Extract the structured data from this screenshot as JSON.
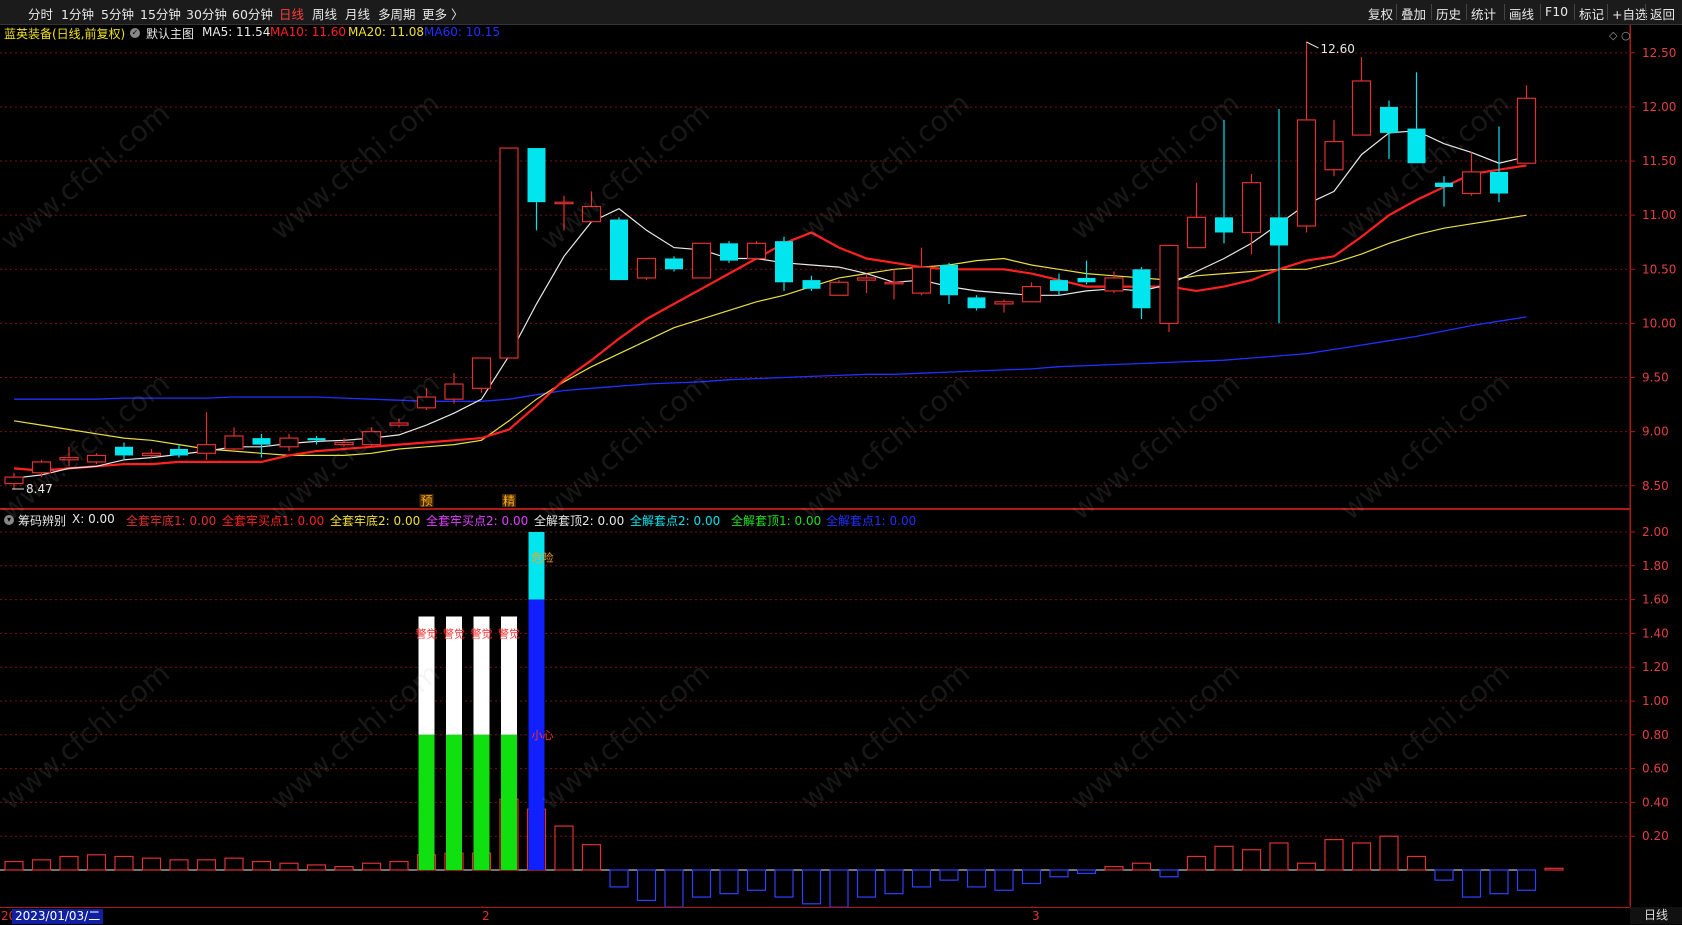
{
  "toolbar": {
    "periods": [
      "分时",
      "1分钟",
      "5分钟",
      "15分钟",
      "30分钟",
      "60分钟",
      "日线",
      "周线",
      "月线",
      "多周期",
      "更多 〉"
    ],
    "active_period": "日线",
    "tools": [
      "复权",
      "叠加",
      "历史",
      "统计",
      "画线",
      "F10",
      "标记",
      "+自选",
      "返回"
    ]
  },
  "main_title": {
    "stock": "蓝英装备(日线,前复权)",
    "chart_name": "默认主图",
    "ma5": "MA5: 11.54",
    "ma10": "MA10: 11.60",
    "ma20": "MA20: 11.08",
    "ma60": "MA60: 10.15"
  },
  "indicator_title": {
    "name": "筹码辨别",
    "x": "X: 0.00",
    "v1": "全套牢底1: 0.00",
    "v2": "全套牢买点1: 0.00",
    "v3": "全套牢底2: 0.00",
    "v4": "全套牢买点2: 0.00",
    "v5": "全解套顶2: 0.00",
    "v6": "全解套点2: 0.00",
    "v7": "全解套顶1: 0.00",
    "v8": "全解套点1: 0.00"
  },
  "price_axis": [
    "12.50",
    "12.00",
    "11.50",
    "11.00",
    "10.50",
    "10.00",
    "9.50",
    "9.00",
    "8.50"
  ],
  "ind_axis": [
    "2.00",
    "1.80",
    "1.60",
    "1.40",
    "1.20",
    "1.00",
    "0.80",
    "0.60",
    "0.40",
    "0.20"
  ],
  "annotations": {
    "high": "12.60",
    "low": "8.47",
    "mark1": "预",
    "mark2": "精",
    "warn": "警觉",
    "danger": "危险",
    "careful": "小心"
  },
  "bottom": {
    "date": "2023/01/03/二",
    "year_prefix": "20",
    "month2": "2",
    "month3": "3",
    "period_label": "日线"
  },
  "watermark": "www.cfchi.com",
  "colors": {
    "up": "#e03030",
    "down": "#00e5ee",
    "ma5": "#e8e8e8",
    "ma10": "#ff2020",
    "ma20": "#e8e040",
    "ma60": "#2030ff",
    "grid": "#7a1010"
  },
  "chart_data": {
    "type": "candlestick",
    "candles": [
      {
        "o": 8.52,
        "c": 8.58,
        "h": 8.62,
        "l": 8.47
      },
      {
        "o": 8.62,
        "c": 8.72,
        "h": 8.74,
        "l": 8.58
      },
      {
        "o": 8.74,
        "c": 8.76,
        "h": 8.86,
        "l": 8.68
      },
      {
        "o": 8.72,
        "c": 8.78,
        "h": 8.8,
        "l": 8.7
      },
      {
        "o": 8.86,
        "c": 8.78,
        "h": 8.9,
        "l": 8.74
      },
      {
        "o": 8.78,
        "c": 8.8,
        "h": 8.84,
        "l": 8.76
      },
      {
        "o": 8.84,
        "c": 8.78,
        "h": 8.88,
        "l": 8.76
      },
      {
        "o": 8.8,
        "c": 8.88,
        "h": 9.18,
        "l": 8.74
      },
      {
        "o": 8.84,
        "c": 8.96,
        "h": 9.04,
        "l": 8.82
      },
      {
        "o": 8.94,
        "c": 8.88,
        "h": 8.98,
        "l": 8.76
      },
      {
        "o": 8.86,
        "c": 8.94,
        "h": 8.98,
        "l": 8.82
      },
      {
        "o": 8.94,
        "c": 8.92,
        "h": 8.96,
        "l": 8.88
      },
      {
        "o": 8.88,
        "c": 8.9,
        "h": 8.94,
        "l": 8.86
      },
      {
        "o": 8.88,
        "c": 9.0,
        "h": 9.04,
        "l": 8.86
      },
      {
        "o": 9.06,
        "c": 9.08,
        "h": 9.12,
        "l": 9.04
      },
      {
        "o": 9.22,
        "c": 9.32,
        "h": 9.4,
        "l": 9.2
      },
      {
        "o": 9.3,
        "c": 9.44,
        "h": 9.54,
        "l": 9.26
      },
      {
        "o": 9.4,
        "c": 9.68,
        "h": 9.68,
        "l": 9.36
      },
      {
        "o": 9.68,
        "c": 11.62,
        "h": 11.62,
        "l": 9.68
      },
      {
        "o": 11.62,
        "c": 11.12,
        "h": 11.62,
        "l": 10.86
      },
      {
        "o": 11.12,
        "c": 11.12,
        "h": 11.18,
        "l": 10.86
      },
      {
        "o": 10.94,
        "c": 11.08,
        "h": 11.22,
        "l": 10.94
      },
      {
        "o": 10.96,
        "c": 10.4,
        "h": 10.98,
        "l": 10.4
      },
      {
        "o": 10.42,
        "c": 10.6,
        "h": 10.6,
        "l": 10.4
      },
      {
        "o": 10.6,
        "c": 10.5,
        "h": 10.62,
        "l": 10.48
      },
      {
        "o": 10.42,
        "c": 10.74,
        "h": 10.74,
        "l": 10.42
      },
      {
        "o": 10.74,
        "c": 10.58,
        "h": 10.76,
        "l": 10.56
      },
      {
        "o": 10.6,
        "c": 10.74,
        "h": 10.76,
        "l": 10.6
      },
      {
        "o": 10.76,
        "c": 10.38,
        "h": 10.8,
        "l": 10.3
      },
      {
        "o": 10.4,
        "c": 10.32,
        "h": 10.44,
        "l": 10.3
      },
      {
        "o": 10.26,
        "c": 10.38,
        "h": 10.4,
        "l": 10.26
      },
      {
        "o": 10.4,
        "c": 10.42,
        "h": 10.46,
        "l": 10.28
      },
      {
        "o": 10.38,
        "c": 10.38,
        "h": 10.5,
        "l": 10.22
      },
      {
        "o": 10.28,
        "c": 10.52,
        "h": 10.7,
        "l": 10.26
      },
      {
        "o": 10.54,
        "c": 10.26,
        "h": 10.56,
        "l": 10.18
      },
      {
        "o": 10.24,
        "c": 10.14,
        "h": 10.26,
        "l": 10.12
      },
      {
        "o": 10.18,
        "c": 10.2,
        "h": 10.22,
        "l": 10.1
      },
      {
        "o": 10.2,
        "c": 10.34,
        "h": 10.38,
        "l": 10.2
      },
      {
        "o": 10.4,
        "c": 10.3,
        "h": 10.46,
        "l": 10.26
      },
      {
        "o": 10.42,
        "c": 10.38,
        "h": 10.58,
        "l": 10.36
      },
      {
        "o": 10.3,
        "c": 10.42,
        "h": 10.48,
        "l": 10.28
      },
      {
        "o": 10.5,
        "c": 10.14,
        "h": 10.52,
        "l": 10.04
      },
      {
        "o": 10.0,
        "c": 10.72,
        "h": 10.72,
        "l": 9.92
      },
      {
        "o": 10.7,
        "c": 10.98,
        "h": 11.3,
        "l": 10.7
      },
      {
        "o": 10.98,
        "c": 10.84,
        "h": 11.88,
        "l": 10.74
      },
      {
        "o": 10.84,
        "c": 11.3,
        "h": 11.38,
        "l": 10.64
      },
      {
        "o": 10.98,
        "c": 10.72,
        "h": 11.98,
        "l": 10.0
      },
      {
        "o": 10.9,
        "c": 11.88,
        "h": 12.6,
        "l": 10.84
      },
      {
        "o": 11.42,
        "c": 11.68,
        "h": 11.88,
        "l": 11.36
      },
      {
        "o": 11.74,
        "c": 12.24,
        "h": 12.46,
        "l": 11.74
      },
      {
        "o": 12.0,
        "c": 11.76,
        "h": 12.06,
        "l": 11.52
      },
      {
        "o": 11.8,
        "c": 11.48,
        "h": 12.32,
        "l": 11.48
      },
      {
        "o": 11.3,
        "c": 11.26,
        "h": 11.36,
        "l": 11.08
      },
      {
        "o": 11.2,
        "c": 11.4,
        "h": 11.58,
        "l": 11.18
      },
      {
        "o": 11.4,
        "c": 11.2,
        "h": 11.82,
        "l": 11.12
      },
      {
        "o": 11.48,
        "c": 12.08,
        "h": 12.2,
        "l": 11.48
      }
    ],
    "ma5": [
      8.57,
      8.6,
      8.66,
      8.68,
      8.74,
      8.76,
      8.79,
      8.82,
      8.86,
      8.86,
      8.89,
      8.91,
      8.92,
      8.94,
      8.97,
      9.06,
      9.17,
      9.3,
      9.7,
      10.18,
      10.62,
      10.94,
      11.06,
      10.86,
      10.7,
      10.68,
      10.6,
      10.6,
      10.56,
      10.54,
      10.52,
      10.46,
      10.38,
      10.4,
      10.34,
      10.3,
      10.28,
      10.26,
      10.26,
      10.3,
      10.32,
      10.3,
      10.36,
      10.48,
      10.6,
      10.74,
      10.92,
      11.1,
      11.22,
      11.56,
      11.76,
      11.78,
      11.66,
      11.58,
      11.48,
      11.54
    ],
    "ma10": [
      8.66,
      8.64,
      8.66,
      8.68,
      8.7,
      8.7,
      8.72,
      8.72,
      8.72,
      8.72,
      8.78,
      8.82,
      8.84,
      8.86,
      8.88,
      8.9,
      8.92,
      8.94,
      9.02,
      9.24,
      9.48,
      9.66,
      9.86,
      10.04,
      10.18,
      10.32,
      10.46,
      10.6,
      10.74,
      10.84,
      10.7,
      10.6,
      10.56,
      10.52,
      10.5,
      10.5,
      10.5,
      10.46,
      10.4,
      10.34,
      10.34,
      10.34,
      10.34,
      10.3,
      10.34,
      10.4,
      10.5,
      10.58,
      10.62,
      10.8,
      11.0,
      11.14,
      11.26,
      11.38,
      11.42,
      11.46,
      11.5,
      11.6
    ],
    "ma20": [
      9.1,
      9.06,
      9.02,
      8.98,
      8.94,
      8.92,
      8.88,
      8.84,
      8.82,
      8.8,
      8.78,
      8.78,
      8.78,
      8.8,
      8.84,
      8.86,
      8.88,
      8.92,
      9.1,
      9.3,
      9.46,
      9.6,
      9.72,
      9.84,
      9.96,
      10.04,
      10.12,
      10.2,
      10.26,
      10.34,
      10.42,
      10.46,
      10.5,
      10.52,
      10.54,
      10.58,
      10.6,
      10.54,
      10.5,
      10.46,
      10.44,
      10.42,
      10.4,
      10.44,
      10.46,
      10.48,
      10.5,
      10.5,
      10.56,
      10.64,
      10.74,
      10.82,
      10.88,
      10.92,
      10.96,
      11.0,
      11.08
    ],
    "ma60": [
      9.3,
      9.3,
      9.3,
      9.3,
      9.31,
      9.31,
      9.31,
      9.31,
      9.32,
      9.32,
      9.32,
      9.32,
      9.31,
      9.3,
      9.29,
      9.28,
      9.28,
      9.28,
      9.3,
      9.34,
      9.38,
      9.4,
      9.42,
      9.44,
      9.45,
      9.46,
      9.48,
      9.49,
      9.5,
      9.51,
      9.52,
      9.53,
      9.53,
      9.54,
      9.55,
      9.56,
      9.57,
      9.58,
      9.6,
      9.61,
      9.62,
      9.63,
      9.64,
      9.65,
      9.66,
      9.68,
      9.7,
      9.72,
      9.76,
      9.8,
      9.84,
      9.88,
      9.93,
      9.98,
      10.02,
      10.06,
      10.1,
      10.15
    ],
    "indicator": {
      "base": [
        0.05,
        0.06,
        0.08,
        0.09,
        0.08,
        0.07,
        0.06,
        0.06,
        0.07,
        0.05,
        0.04,
        0.03,
        0.02,
        0.04,
        0.05,
        0.09,
        0.1,
        0.1,
        0.42,
        0.36,
        0.26,
        0.15,
        -0.1,
        -0.18,
        -0.22,
        -0.16,
        -0.14,
        -0.12,
        -0.16,
        -0.2,
        -0.22,
        -0.16,
        -0.14,
        -0.1,
        -0.06,
        -0.1,
        -0.12,
        -0.08,
        -0.04,
        -0.02,
        0.02,
        0.04,
        -0.04,
        0.08,
        0.14,
        0.12,
        0.16,
        0.04,
        0.18,
        0.16,
        0.2,
        0.08,
        -0.06,
        -0.16,
        -0.14,
        -0.12,
        0.01
      ],
      "tall_bars": [
        {
          "index": 15,
          "green": 0.8,
          "white": 1.5
        },
        {
          "index": 16,
          "green": 0.8,
          "white": 1.5
        },
        {
          "index": 17,
          "green": 0.8,
          "white": 1.5
        },
        {
          "index": 18,
          "green": 0.8,
          "white": 1.5
        },
        {
          "index": 19,
          "blue": 1.6,
          "cyan": 2.0
        }
      ]
    },
    "ylim_price": [
      8.4,
      12.7
    ],
    "ylim_ind": [
      -0.2,
      2.1
    ]
  }
}
